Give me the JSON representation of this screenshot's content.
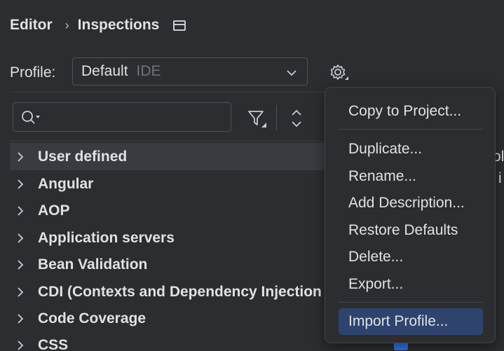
{
  "breadcrumb": {
    "parent": "Editor",
    "separator": "›",
    "current": "Inspections"
  },
  "profile": {
    "label": "Profile:",
    "value": "Default",
    "scope": "IDE"
  },
  "search": {
    "value": "",
    "placeholder": ""
  },
  "tree": {
    "items": [
      {
        "label": "User defined",
        "selected": true
      },
      {
        "label": "Angular"
      },
      {
        "label": "AOP"
      },
      {
        "label": "Application servers"
      },
      {
        "label": "Bean Validation"
      },
      {
        "label": "CDI (Contexts and Dependency Injection"
      },
      {
        "label": "Code Coverage"
      },
      {
        "label": "CSS"
      }
    ]
  },
  "clipped_right": {
    "line1": "ol",
    "line2": "i"
  },
  "menu": {
    "items": [
      {
        "label": "Copy to Project..."
      },
      {
        "label": "Duplicate..."
      },
      {
        "label": "Rename..."
      },
      {
        "label": "Add Description..."
      },
      {
        "label": "Restore Defaults"
      },
      {
        "label": "Delete..."
      },
      {
        "label": "Export..."
      },
      {
        "label": "Import Profile...",
        "active": true
      }
    ]
  },
  "colors": {
    "background": "#2b2d30",
    "menu_active": "#2e436e",
    "accent": "#3574f0"
  }
}
